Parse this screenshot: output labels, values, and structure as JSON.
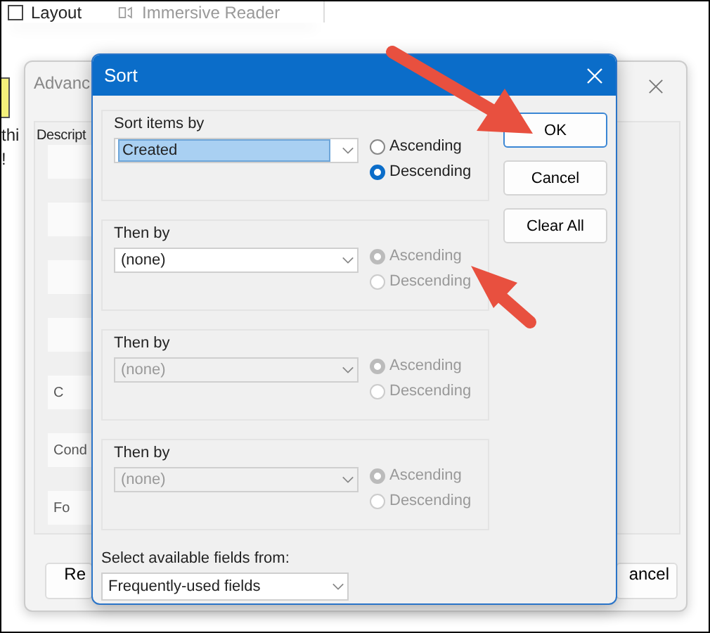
{
  "ribbon": {
    "items": [
      {
        "label": "Layout"
      },
      {
        "label": "Immersive Reader"
      }
    ]
  },
  "background_dialog": {
    "title": "Advanc",
    "label": "Descript",
    "side_texts": [
      "thi",
      "!"
    ],
    "side_buttons": [
      "C",
      "Cond",
      "Fo"
    ],
    "footer_buttons": [
      "Re",
      "ancel"
    ]
  },
  "sort_dialog": {
    "title": "Sort",
    "sections": [
      {
        "label": "Sort items by",
        "field": "Created",
        "highlighted": true,
        "field_disabled": false,
        "order_disabled": false,
        "options": [
          {
            "label": "Ascending",
            "selected": false
          },
          {
            "label": "Descending",
            "selected": true
          }
        ]
      },
      {
        "label": "Then by",
        "field": "(none)",
        "highlighted": false,
        "field_disabled": false,
        "order_disabled": true,
        "options": [
          {
            "label": "Ascending",
            "selected": true
          },
          {
            "label": "Descending",
            "selected": false
          }
        ]
      },
      {
        "label": "Then by",
        "field": "(none)",
        "highlighted": false,
        "field_disabled": true,
        "order_disabled": true,
        "options": [
          {
            "label": "Ascending",
            "selected": true
          },
          {
            "label": "Descending",
            "selected": false
          }
        ]
      },
      {
        "label": "Then by",
        "field": "(none)",
        "highlighted": false,
        "field_disabled": true,
        "order_disabled": true,
        "options": [
          {
            "label": "Ascending",
            "selected": true
          },
          {
            "label": "Descending",
            "selected": false
          }
        ]
      }
    ],
    "fields_from": {
      "label": "Select available fields from:",
      "value": "Frequently-used fields"
    },
    "buttons": [
      {
        "label": "OK",
        "default": true
      },
      {
        "label": "Cancel",
        "default": false
      },
      {
        "label": "Clear All",
        "default": false
      }
    ]
  }
}
